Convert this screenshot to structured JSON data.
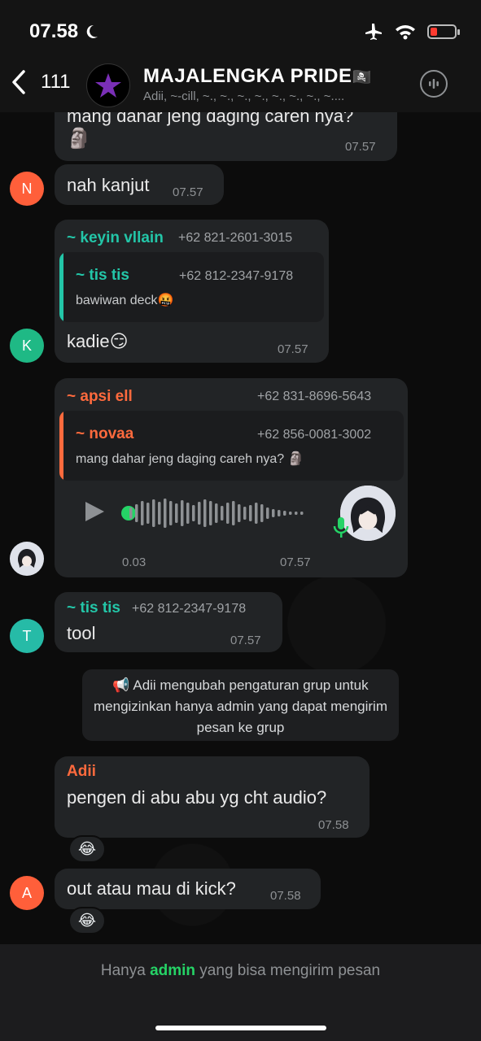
{
  "status_bar": {
    "time": "07.58"
  },
  "header": {
    "back_count": "111",
    "title": "MAJALENGKA PRIDE",
    "title_flag": "🏴‍☠️",
    "subtitle": "Adii, ~-cill, ~., ~., ~., ~., ~., ~., ~., ~...."
  },
  "messages": [
    {
      "text": "mang dahar jeng daging careh nya?",
      "emoji": "🗿",
      "time": "07.57"
    },
    {
      "avatar": "N",
      "avatar_color": "#ff5f3a",
      "text": "nah kanjut",
      "time": "07.57"
    },
    {
      "avatar": "K",
      "avatar_color": "#1fb985",
      "name": "~ keyin vllain",
      "phone": "+62 821-2601-3015",
      "quote": {
        "name": "~ tis tis",
        "phone": "+62 812-2347-9178",
        "text": "bawiwan deck🤬"
      },
      "text": "kadie😏",
      "time": "07.57"
    },
    {
      "name": "~ apsi ell",
      "phone": "+62 831-8696-5643",
      "quote": {
        "name": "~ novaa",
        "phone": "+62 856-0081-3002",
        "text": "mang dahar jeng daging careh nya? 🗿"
      },
      "audio": {
        "duration": "0.03",
        "progress": 0
      },
      "time": "07.57"
    },
    {
      "avatar": "T",
      "avatar_color": "#26bba7",
      "name": "~ tis tis",
      "phone": "+62 812-2347-9178",
      "text": "tool",
      "time": "07.57"
    },
    {
      "system": "📢 Adii mengubah pengaturan grup untuk mengizinkan hanya admin yang dapat mengirim pesan ke grup"
    },
    {
      "name": "Adii",
      "text": "pengen di abu abu yg cht audio?",
      "time": "07.58",
      "reaction": "😂"
    },
    {
      "avatar": "A",
      "avatar_color": "#ff5f3a",
      "text": "out atau mau di kick?",
      "time": "07.58",
      "reaction": "😂"
    }
  ],
  "footer": {
    "prefix": "Hanya ",
    "admin": "admin",
    "suffix": " yang bisa mengirim pesan"
  },
  "colors": {
    "teal_name": "#23c6a8",
    "orange_name": "#ff6a3d",
    "accent_green": "#25d366"
  }
}
